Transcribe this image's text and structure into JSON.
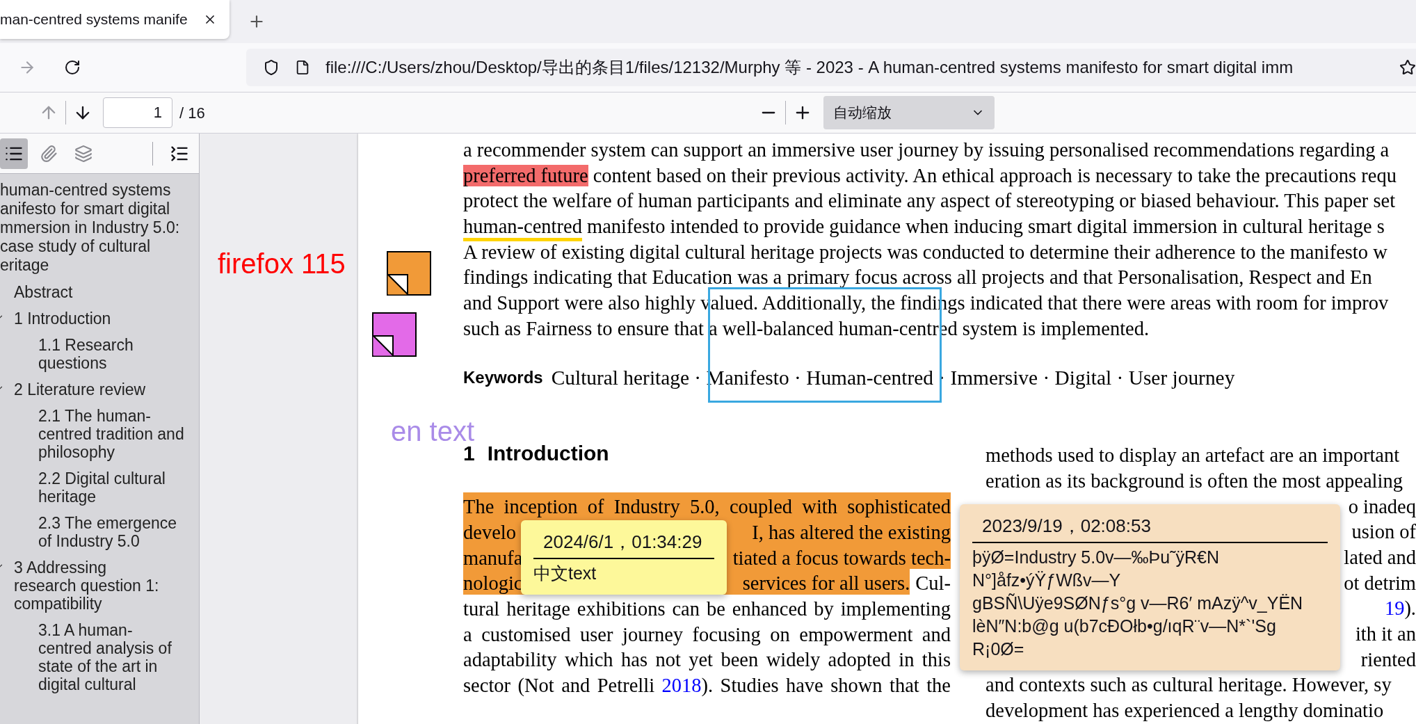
{
  "browser": {
    "tab": {
      "title": "man-centred systems manife"
    },
    "nav": {
      "forward_disabled": true
    },
    "url": "file:///C:/Users/zhou/Desktop/导出的条目1/files/12132/Murphy 等 - 2023 - A human-centred systems manifesto for smart digital imm"
  },
  "pdf_toolbar": {
    "previous_disabled": true,
    "next_disabled": false,
    "page": "1",
    "page_count": "/ 16",
    "zoom": "自动缩放"
  },
  "sidebar": {
    "buttons": [
      {
        "kind": "outline",
        "selected": true
      },
      {
        "kind": "attachments",
        "selected": false
      },
      {
        "kind": "layers",
        "selected": false
      }
    ],
    "outline": [
      {
        "title_lines": [
          "human-centred systems",
          "anifesto for smart digital",
          "mmersion in Industry 5.0:",
          "case study of cultural",
          "eritage"
        ],
        "children": [
          {
            "title": "Abstract"
          },
          {
            "title": "1 Introduction",
            "expanded": true,
            "children": [
              {
                "title": "1.1 Research questions"
              }
            ]
          },
          {
            "title": "2 Literature review",
            "expanded": true,
            "children": [
              {
                "title": "2.1 The human-centred tradition and philosophy"
              },
              {
                "title": "2.2 Digital cultural heritage"
              },
              {
                "title": "2.3 The emergence of Industry 5.0"
              }
            ]
          },
          {
            "title": "3 Addressing research question 1: compatibility",
            "expanded": true,
            "children": [
              {
                "title": "3.1 A human-centred analysis of state of the art in digital cultural"
              }
            ]
          }
        ]
      }
    ]
  },
  "annotations": [
    {
      "kind": "text",
      "text": "firefox 115",
      "color": "#ff0000"
    },
    {
      "kind": "text",
      "text": "en text",
      "color": "#a98be8"
    },
    {
      "kind": "note",
      "color": "#f19a38"
    },
    {
      "kind": "note",
      "color": "#e36ae8"
    },
    {
      "kind": "square",
      "color": "#3aa8e0"
    }
  ],
  "page": {
    "abstract_lines": [
      {
        "parts": [
          {
            "text": "a recommender system can support an immersive user journey by issuing personalised recommendations regarding a"
          }
        ]
      },
      {
        "parts": [
          {
            "text": "preferred future",
            "kind": "highlight",
            "color": "#f36b6b"
          },
          {
            "text": " content based on their previous activity. An ethical approach is necessary to take the precautions requ"
          }
        ]
      },
      {
        "parts": [
          {
            "text": "protect the welfare of human participants and eliminate any aspect of stereotyping or biased behaviour. This paper set"
          }
        ]
      },
      {
        "parts": [
          {
            "text": "human-centred",
            "kind": "underline",
            "color": "#ffd400"
          },
          {
            "text": " manifesto intended to provide guidance when inducing smart digital immersion in cultural heritage s"
          }
        ]
      },
      {
        "parts": [
          {
            "text": "A review of existing digital cultural heritage projects was conducted to determine their adherence to the manifesto w"
          }
        ]
      },
      {
        "parts": [
          {
            "text": "findings indicating that Education was a primary focus across all projects and that Personalisation, Respect and En"
          }
        ]
      },
      {
        "parts": [
          {
            "text": "and Support were also highly valued. Additionally, the findings indicated that there were areas with room for improv"
          }
        ]
      },
      {
        "parts": [
          {
            "text": "such as Fairness to ensure that a well-balanced human-centred system is implemented."
          }
        ]
      }
    ],
    "keywords": {
      "label": "Keywords",
      "text": "Cultural heritage · Manifesto · Human-centred · Immersive · Digital · User journey"
    },
    "heading": {
      "number": "1",
      "title": "Introduction"
    },
    "left_column": [
      {
        "kind": "full",
        "parts": [
          {
            "text": "The inception of Industry 5.0, coupled with sophisticated",
            "kind": "highlight",
            "color": "#f19a38"
          }
        ]
      },
      {
        "kind": "split",
        "parts": [
          {
            "text": "develo",
            "kind": "highlight",
            "color": "#f19a38"
          },
          {
            "text": "I, has altered the existing",
            "kind": "highlight",
            "color": "#f19a38"
          }
        ]
      },
      {
        "kind": "split",
        "parts": [
          {
            "text": "manufa",
            "kind": "highlight",
            "color": "#f19a38"
          },
          {
            "text": "tiated a focus towards tech-",
            "kind": "highlight",
            "color": "#f19a38"
          }
        ]
      },
      {
        "kind": "split",
        "parts": [
          {
            "text": "nologic",
            "kind": "highlight",
            "color": "#f19a38"
          },
          {
            "text": "services for all users.",
            "kind": "highlight",
            "color": "#f19a38"
          },
          {
            "text": "Cul-"
          }
        ]
      },
      {
        "kind": "full",
        "parts": [
          {
            "text": "tural heritage exhibitions can be enhanced by implementing"
          }
        ]
      },
      {
        "kind": "full",
        "parts": [
          {
            "text": "a customised user journey focusing on empowerment and"
          }
        ]
      },
      {
        "kind": "full",
        "parts": [
          {
            "text": "adaptability which has not yet been widely adopted in this"
          }
        ]
      },
      {
        "kind": "full",
        "parts": [
          {
            "text": "sector (Not and Petrelli "
          },
          {
            "text": "2018",
            "kind": "link"
          },
          {
            "text": "). Studies have shown that the"
          }
        ]
      }
    ],
    "right_column": [
      {
        "kind": "full",
        "parts": [
          {
            "text": "methods used to display an artefact are an important"
          }
        ]
      },
      {
        "kind": "full",
        "parts": [
          {
            "text": "eration as its background is often the most appealing"
          }
        ]
      },
      {
        "kind": "tail",
        "parts": [
          {
            "text": "o inadeq"
          }
        ]
      },
      {
        "kind": "tail",
        "parts": [
          {
            "text": "usion of"
          }
        ]
      },
      {
        "kind": "tail",
        "parts": [
          {
            "text": "lated and"
          }
        ]
      },
      {
        "kind": "tail",
        "parts": [
          {
            "text": "ot detrim"
          }
        ]
      },
      {
        "kind": "tail",
        "parts": [
          {
            "text": "19",
            "kind": "link"
          },
          {
            "text": ")."
          }
        ]
      },
      {
        "kind": "tail",
        "parts": [
          {
            "text": "ith it an"
          }
        ]
      },
      {
        "kind": "tail",
        "parts": [
          {
            "text": "riented"
          }
        ]
      },
      {
        "kind": "full",
        "parts": [
          {
            "text": "and contexts such as cultural heritage. However, sy"
          }
        ]
      },
      {
        "kind": "full",
        "parts": [
          {
            "text": "development has experienced a lengthy dominatio"
          }
        ]
      }
    ]
  },
  "popups": [
    {
      "date": "2024/6/1，01:34:29",
      "lines": [
        "中文text"
      ],
      "color": "#fdf89a"
    },
    {
      "date": "2023/9/19，02:08:53",
      "lines": [
        "þÿØ=Industry 5.0v—‰Þu˜ÿR€N",
        "N°]åfz•ýŸƒWßv—Y",
        "gBSÑ\\Uÿe9SØNƒs°g v—R6′ mAzÿ^v_YËN",
        "lèN″N:b@g u(b7cĐOłb•g/ıqR¨v—N*`'Sg",
        "R¡0Ø="
      ],
      "color": "#f7dfc0"
    }
  ]
}
